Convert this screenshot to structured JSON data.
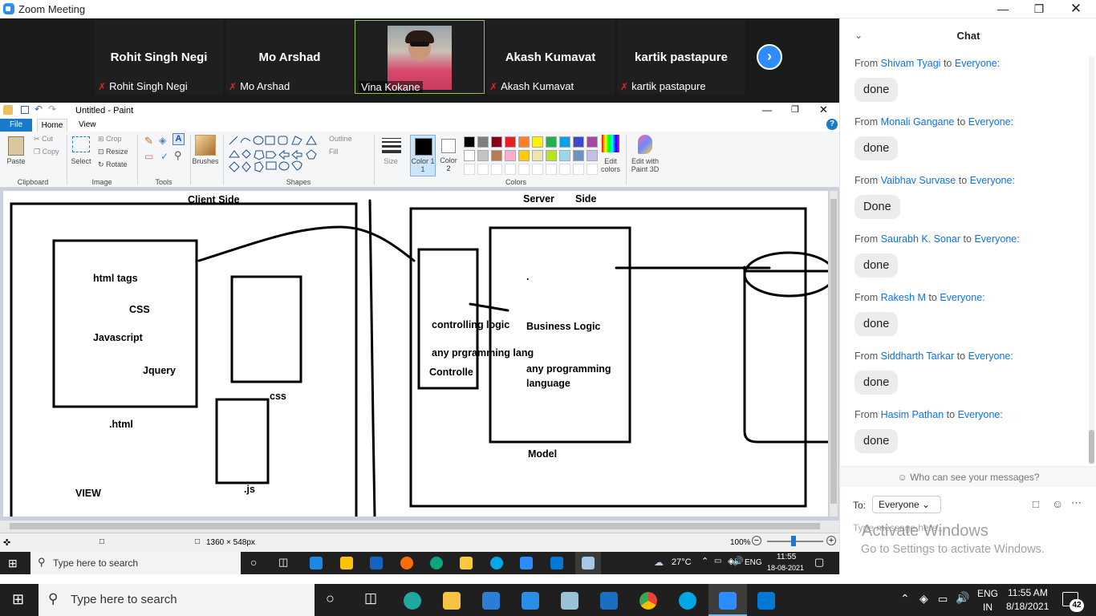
{
  "window": {
    "title": "Zoom Meeting"
  },
  "participants": [
    {
      "name": "Rohit Singh Negi",
      "label": "Rohit Singh Negi",
      "muted": true
    },
    {
      "name": "Mo Arshad",
      "label": "Mo Arshad",
      "muted": true
    },
    {
      "name": "",
      "label": "Vina Kokane",
      "muted": false,
      "active": true
    },
    {
      "name": "Akash Kumavat",
      "label": "Akash Kumavat",
      "muted": true
    },
    {
      "name": "kartik pastapure",
      "label": "kartik pastapure",
      "muted": true
    }
  ],
  "paint": {
    "title": "Untitled - Paint",
    "tabs": {
      "file": "File",
      "home": "Home",
      "view": "View"
    },
    "clipboard": {
      "paste": "Paste",
      "cut": "Cut",
      "copy": "Copy",
      "group": "Clipboard"
    },
    "image": {
      "select": "Select",
      "crop": "Crop",
      "resize": "Resize",
      "rotate": "Rotate",
      "group": "Image"
    },
    "tools": {
      "group": "Tools"
    },
    "brushes": "Brushes",
    "shapes": {
      "outline": "Outline",
      "fill": "Fill",
      "group": "Shapes"
    },
    "size": "Size",
    "color1": "Color 1",
    "color1b": "1",
    "color2": "Color 2",
    "color2b": "2",
    "colors_group": "Colors",
    "edit_colors": "Edit colors",
    "edit_colors_b": "colors",
    "edit_3d": "Edit with",
    "edit_3d_b": "Paint 3D",
    "palette": [
      "#000000",
      "#7f7f7f",
      "#880015",
      "#ed1c24",
      "#ff7f27",
      "#fff200",
      "#22b14c",
      "#00a2e8",
      "#3f48cc",
      "#a349a4",
      "#ffffff",
      "#c3c3c3",
      "#b97a57",
      "#ffaec9",
      "#ffc90e",
      "#efe4b0",
      "#b5e61d",
      "#99d9ea",
      "#7092be",
      "#c8bfe7"
    ],
    "status": {
      "dimensions": "1360 × 548px",
      "zoom": "100%"
    },
    "drawing": {
      "client_side": "Client Side",
      "server": "Server",
      "side": "Side",
      "html_tags": "html tags",
      "css_inner": "CSS",
      "javascript": "Javascript",
      "jquery": "Jquery",
      "html_ext": ".html",
      "view": "VIEW",
      "css_ext": "css",
      "js_ext": ".js",
      "controlling_logic": "controlling logic",
      "any_prog_lang": "any prgramming lang",
      "controller": "Controlle",
      "dot": ".",
      "business_logic": "Business Logic",
      "any_programming": "any programming",
      "language": "language",
      "model": "Model"
    }
  },
  "inner_taskbar": {
    "search": "Type here to search",
    "weather": "27°C",
    "lang": "ENG",
    "time": "11:55",
    "date": "18-08-2021"
  },
  "chat": {
    "title": "Chat",
    "messages": [
      {
        "from": "From",
        "user": "Shivam Tyagi",
        "to": "to",
        "target": "Everyone:",
        "text": "done"
      },
      {
        "from": "From",
        "user": "Monali Gangane",
        "to": "to",
        "target": "Everyone:",
        "text": "done"
      },
      {
        "from": "From",
        "user": "Vaibhav Survase",
        "to": "to",
        "target": "Everyone:",
        "text": "Done"
      },
      {
        "from": "From",
        "user": "Saurabh K. Sonar",
        "to": "to",
        "target": "Everyone:",
        "text": "done"
      },
      {
        "from": "From",
        "user": "Rakesh M",
        "to": "to",
        "target": "Everyone:",
        "text": "done"
      },
      {
        "from": "From",
        "user": "Siddharth Tarkar",
        "to": "to",
        "target": "Everyone:",
        "text": "done"
      },
      {
        "from": "From",
        "user": "Hasim Pathan",
        "to": "to",
        "target": "Everyone:",
        "text": "done"
      }
    ],
    "visibility_note": "Who can see your messages?",
    "to_label": "To:",
    "to_value": "Everyone",
    "input_placeholder": "Type message here..."
  },
  "watermark": {
    "line1": "Activate Windows",
    "line2": "Go to Settings to activate Windows."
  },
  "taskbar": {
    "search": "Type here to search",
    "lang1": "ENG",
    "lang2": "IN",
    "time": "11:55 AM",
    "date": "8/18/2021",
    "notifications": "42"
  }
}
